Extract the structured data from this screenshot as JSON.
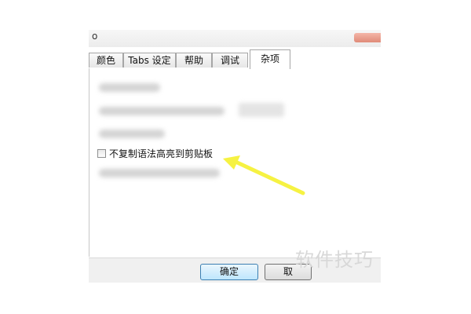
{
  "window": {
    "title_fragment": "o"
  },
  "tabs": [
    {
      "label": "颜色",
      "active": false
    },
    {
      "label": "Tabs 设定",
      "active": false
    },
    {
      "label": "帮助",
      "active": false
    },
    {
      "label": "调试",
      "active": false
    },
    {
      "label": "杂项",
      "active": true
    }
  ],
  "options": {
    "no_copy_syntax_highlight": {
      "label": "不复制语法高亮到剪贴板",
      "checked": false
    }
  },
  "buttons": {
    "ok": "确定",
    "cancel": "取"
  },
  "watermark": "软件技巧",
  "colors": {
    "arrow": "#f6f242",
    "default_button": "#bee6fd"
  }
}
